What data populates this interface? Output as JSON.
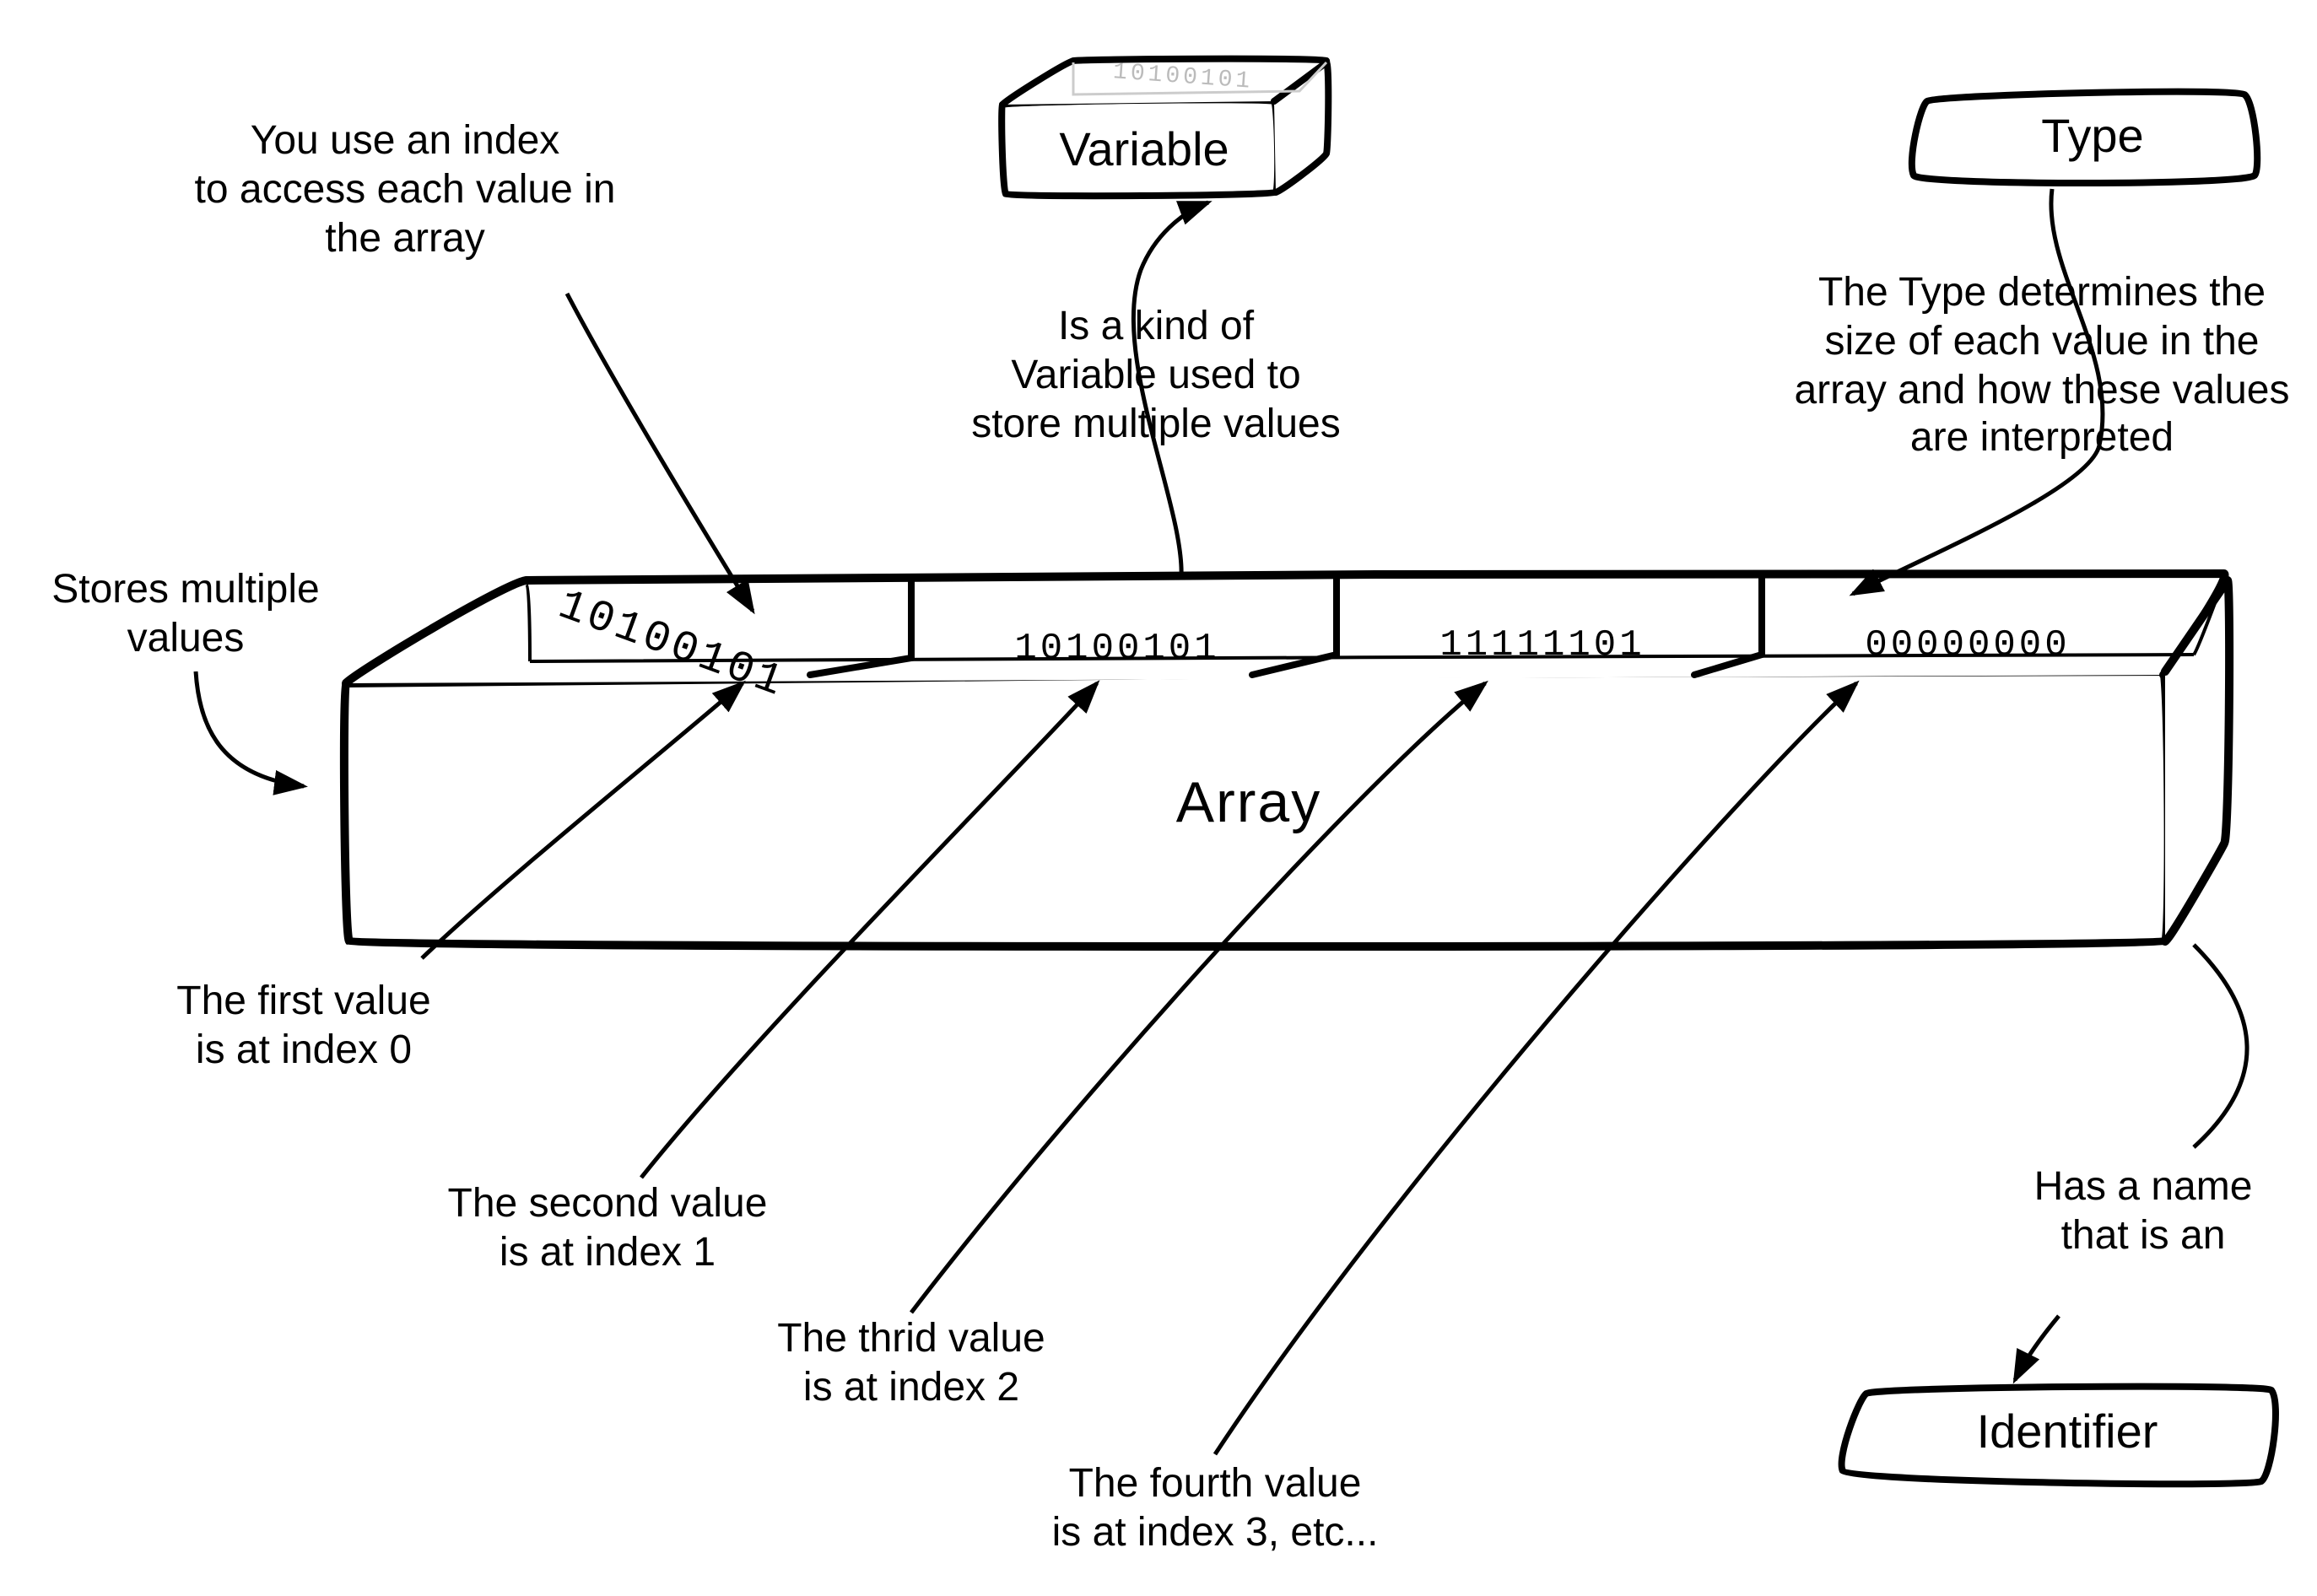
{
  "title": "Array",
  "boxes": {
    "variable": "Variable",
    "type": "Type",
    "identifier": "Identifier"
  },
  "binary": {
    "cell0_tilted": "10100101",
    "cell1": "10100101",
    "cell2": "11111101",
    "cell3": "00000000",
    "variable_box": "10100101"
  },
  "annotations": {
    "index_access": "You use an index\nto access each value in\nthe array",
    "stores_multiple": "Stores multiple\nvalues",
    "is_kind_of": "Is a kind of\nVariable used to\nstore multiple values",
    "type_determines": "The Type determines the\nsize of each value in the\narray and how these values\nare interpreted",
    "idx0": "The first value\nis at index 0",
    "idx1": "The second value\nis at index 1",
    "idx2": "The thrid value\nis at index 2",
    "idx3": "The fourth value\nis at index 3, etc...",
    "has_name": "Has a name\nthat is an"
  }
}
